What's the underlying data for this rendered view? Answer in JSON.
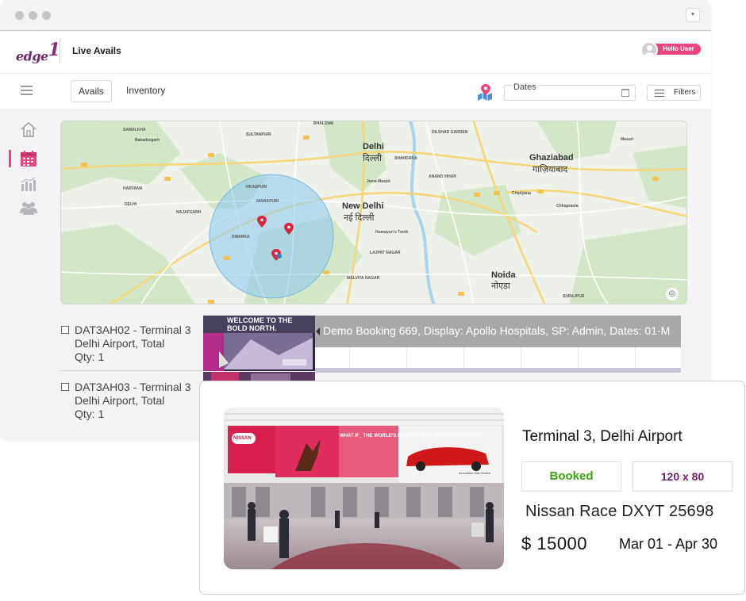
{
  "window": {
    "controls": [
      "close-dot",
      "minimize-dot",
      "maximize-dot"
    ]
  },
  "app": {
    "logo": "edge",
    "logo_mark": "1",
    "title": "Live Avails"
  },
  "user": {
    "greeting": "Hello User"
  },
  "toolbar": {
    "tabs": [
      {
        "label": "Avails",
        "active": true
      },
      {
        "label": "Inventory",
        "active": false
      }
    ],
    "dates_label": "Dates",
    "filters_label": "Filters"
  },
  "sidebar": {
    "items": [
      "home",
      "calendar",
      "reports",
      "users"
    ],
    "active": "calendar",
    "accent": "#e8457f"
  },
  "map": {
    "cities": [
      {
        "en": "Delhi",
        "local": "दिल्ली"
      },
      {
        "en": "New Delhi",
        "local": "नई दिल्ली"
      },
      {
        "en": "Ghaziabad",
        "local": "गाज़ियाबाद"
      },
      {
        "en": "Noida",
        "local": "नोएडा"
      }
    ],
    "places": [
      "SAMALKHA",
      "Bahadurgarh",
      "SULTANPURI",
      "BHALSWA",
      "DILSHAD GARDEN",
      "SHAHDARA",
      "ANAND VIHAR",
      "VIKASPURI",
      "JANAKPURI",
      "HARYANA",
      "DELHI",
      "NAJAFGARH",
      "DWARKA",
      "Jama Masjid",
      "Humayun's Tomb",
      "LAJPAT NAGAR",
      "MALVIYA NAGAR",
      "SURAJPUR",
      "Chhapraula",
      "Masuri",
      "Chipiyana"
    ],
    "marker_count": 3
  },
  "inventory": [
    {
      "code": "DAT3AH02 - Terminal 3",
      "location": "Delhi Airport, Total",
      "qty": "Qty: 1"
    },
    {
      "code": "DAT3AH03 - Terminal 3",
      "location": "Delhi Airport, Total",
      "qty": "Qty: 1"
    }
  ],
  "thumbnail_text": "WELCOME TO THE BOLD NORTH.",
  "booking": {
    "label": "Demo Booking 669, Display: Apollo Hospitals, SP: Admin, Dates: 01-M"
  },
  "detail": {
    "location": "Terminal 3, Delhi Airport",
    "status": "Booked",
    "status_color": "#3aa80f",
    "size": "120 x 80",
    "size_color": "#6b1f6b",
    "campaign": "Nissan Race DXYT 25698",
    "price": "$ 15000",
    "date_range": "Mar 01 - Apr 30",
    "photo_text": {
      "banner": "WHAT IF_ THE WORLD'S FASTEST MAN WENT EVEN FASTER?",
      "brand": "NISSAN",
      "tagline": "Innovation that excites"
    }
  }
}
